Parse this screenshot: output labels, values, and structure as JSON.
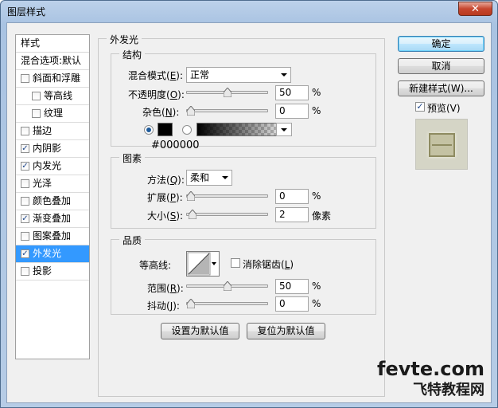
{
  "window": {
    "title": "图层样式",
    "close_glyph": "✕"
  },
  "sidebar": {
    "header": "样式",
    "items": [
      {
        "label": "混合选项:默认",
        "checkbox": false,
        "checked": false,
        "indent": false
      },
      {
        "label": "斜面和浮雕",
        "checkbox": true,
        "checked": false,
        "indent": false
      },
      {
        "label": "等高线",
        "checkbox": true,
        "checked": false,
        "indent": true
      },
      {
        "label": "纹理",
        "checkbox": true,
        "checked": false,
        "indent": true
      },
      {
        "label": "描边",
        "checkbox": true,
        "checked": false,
        "indent": false
      },
      {
        "label": "内阴影",
        "checkbox": true,
        "checked": true,
        "indent": false
      },
      {
        "label": "内发光",
        "checkbox": true,
        "checked": true,
        "indent": false
      },
      {
        "label": "光泽",
        "checkbox": true,
        "checked": false,
        "indent": false
      },
      {
        "label": "颜色叠加",
        "checkbox": true,
        "checked": false,
        "indent": false
      },
      {
        "label": "渐变叠加",
        "checkbox": true,
        "checked": true,
        "indent": false
      },
      {
        "label": "图案叠加",
        "checkbox": true,
        "checked": false,
        "indent": false
      },
      {
        "label": "外发光",
        "checkbox": true,
        "checked": true,
        "indent": false,
        "selected": true
      },
      {
        "label": "投影",
        "checkbox": true,
        "checked": false,
        "indent": false
      }
    ],
    "check_glyph": "✓"
  },
  "outer_glow": {
    "title": "外发光",
    "structure": {
      "title": "结构",
      "blend_mode_label": "混合模式(",
      "blend_mode_key": "E",
      "blend_mode_suffix": "):",
      "blend_mode_value": "正常",
      "opacity_label": "不透明度(",
      "opacity_key": "O",
      "opacity_suffix": "):",
      "opacity_value": "50",
      "noise_label": "杂色(",
      "noise_key": "N",
      "noise_suffix": "):",
      "noise_value": "0",
      "percent": "%",
      "color_hex": "#000000"
    },
    "elements": {
      "title": "图素",
      "method_label": "方法(",
      "method_key": "Q",
      "method_suffix": "):",
      "method_value": "柔和",
      "spread_label": "扩展(",
      "spread_key": "P",
      "spread_suffix": "):",
      "spread_value": "0",
      "size_label": "大小(",
      "size_key": "S",
      "size_suffix": "):",
      "size_value": "2",
      "size_unit": "像素",
      "percent": "%"
    },
    "quality": {
      "title": "品质",
      "contour_label": "等高线:",
      "antialias_label": "消除锯齿(",
      "antialias_key": "L",
      "antialias_suffix": ")",
      "range_label": "范围(",
      "range_key": "R",
      "range_suffix": "):",
      "range_value": "50",
      "jitter_label": "抖动(",
      "jitter_key": "J",
      "jitter_suffix": "):",
      "jitter_value": "0",
      "percent": "%"
    },
    "make_default": "设置为默认值",
    "reset_default": "复位为默认值"
  },
  "right_panel": {
    "ok": "确定",
    "cancel": "取消",
    "new_style": "新建样式(W)...",
    "preview_label": "预览(V)",
    "preview_checked": true
  },
  "slider_levels": {
    "opacity": 0.5,
    "noise": 0,
    "spread": 0,
    "size": 0.02,
    "range": 0.5,
    "jitter": 0
  },
  "colors": {
    "selected_row": "#3399ff",
    "glow_color": "#000000",
    "primary_border": "#3c7fb1"
  },
  "watermark": {
    "line1": "fevte.com",
    "line2": "飞特教程网"
  }
}
